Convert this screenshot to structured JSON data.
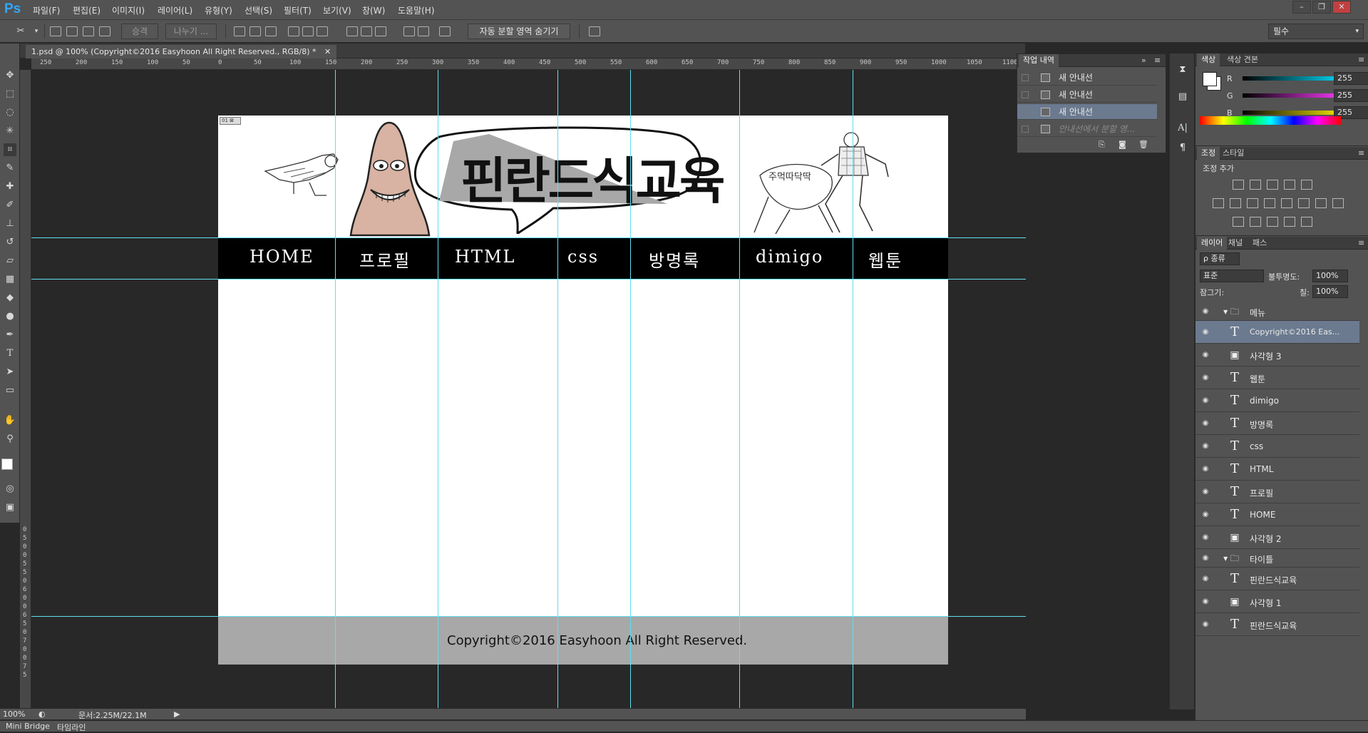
{
  "app": {
    "logo": "Ps"
  },
  "menubar": {
    "items": [
      "파일(F)",
      "편집(E)",
      "이미지(I)",
      "레이어(L)",
      "유형(Y)",
      "선택(S)",
      "필터(T)",
      "보기(V)",
      "창(W)",
      "도움말(H)"
    ]
  },
  "window_controls": {
    "minimize": "–",
    "restore": "❐",
    "close": "✕"
  },
  "options_bar": {
    "promote_label": "승격",
    "divide_label": "나누기 ...",
    "hide_slices_label": "자동 분할 영역 숨기기",
    "workspace_value": "필수"
  },
  "document": {
    "tab_title": "1.psd @ 100% (Copyright©2016 Easyhoon All Right Reserved., RGB/8) *",
    "tab_close": "✕",
    "zoom": "100%",
    "doc_info": "문서:2.25M/22.1M"
  },
  "ruler": {
    "h_ticks": [
      "250",
      "200",
      "150",
      "100",
      "50",
      "0",
      "50",
      "100",
      "150",
      "200",
      "250",
      "300",
      "350",
      "400",
      "450",
      "500",
      "550",
      "600",
      "650",
      "700",
      "750",
      "800",
      "850",
      "900",
      "950",
      "1000",
      "1050",
      "1100"
    ],
    "v_ticks": [
      "0",
      "5",
      "0",
      "0",
      "5",
      "5",
      "0",
      "6",
      "0",
      "0",
      "6",
      "5",
      "0",
      "7",
      "0",
      "0",
      "7",
      "5"
    ]
  },
  "artwork": {
    "title": "핀란드식교육",
    "nav": [
      "HOME",
      "프로필",
      "HTML",
      "css",
      "방명록",
      "dimigo",
      "웹툰"
    ],
    "footer_text": "Copyright©2016 Easyhoon All Right Reserved.",
    "slice_tag": "01 ⊠"
  },
  "history_panel": {
    "tab": "작업 내역",
    "items": [
      {
        "label": "새 안내선",
        "selected": false
      },
      {
        "label": "새 안내선",
        "selected": false
      },
      {
        "label": "새 안내선",
        "selected": true
      },
      {
        "label": "안내선에서 분할 영...",
        "selected": false,
        "ghost": true
      }
    ]
  },
  "color_panel": {
    "tabs": [
      "색상",
      "색상 견본"
    ],
    "r_label": "R",
    "g_label": "G",
    "b_label": "B",
    "r": "255",
    "g": "255",
    "b": "255",
    "r_color": "#00e0ff",
    "g_color": "#ff3cff",
    "b_color": "#fff000"
  },
  "adjust_panel": {
    "tabs": [
      "조정",
      "스타일"
    ],
    "heading": "조정 추가"
  },
  "layers_panel": {
    "tabs": [
      "레이어",
      "채널",
      "패스"
    ],
    "filter_label": "ρ 종류",
    "blend_mode": "표준",
    "opacity_label": "불투명도:",
    "opacity": "100%",
    "lock_label": "잠그기:",
    "fill_label": "칠:",
    "fill": "100%",
    "layers": [
      {
        "name": "메뉴",
        "kind": "group"
      },
      {
        "name": "Copyright©2016 Eas...",
        "kind": "text",
        "selected": true
      },
      {
        "name": "사각형 3",
        "kind": "shape"
      },
      {
        "name": "웹툰",
        "kind": "text"
      },
      {
        "name": "dimigo",
        "kind": "text"
      },
      {
        "name": "방명록",
        "kind": "text"
      },
      {
        "name": "css",
        "kind": "text"
      },
      {
        "name": "HTML",
        "kind": "text"
      },
      {
        "name": "프로필",
        "kind": "text"
      },
      {
        "name": "HOME",
        "kind": "text"
      },
      {
        "name": "사각형 2",
        "kind": "shape"
      },
      {
        "name": "타이틀",
        "kind": "group"
      },
      {
        "name": "핀란드식교육",
        "kind": "text"
      },
      {
        "name": "사각형 1",
        "kind": "shape"
      },
      {
        "name": "핀란드식교육",
        "kind": "text"
      }
    ]
  },
  "bottom_tabs": [
    "Mini Bridge",
    "타임라인"
  ]
}
